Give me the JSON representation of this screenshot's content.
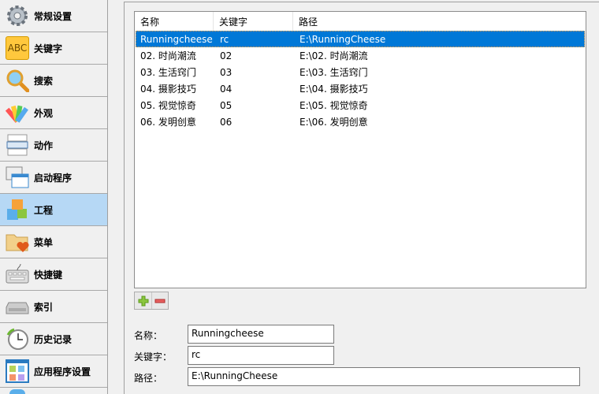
{
  "sidebar": {
    "items": [
      {
        "label": "常规设置",
        "icon": "gear-icon"
      },
      {
        "label": "关键字",
        "icon": "abc-icon",
        "icon_text": "ABC"
      },
      {
        "label": "搜索",
        "icon": "magnifier-icon"
      },
      {
        "label": "外观",
        "icon": "palette-icon"
      },
      {
        "label": "动作",
        "icon": "action-list-icon"
      },
      {
        "label": "启动程序",
        "icon": "windows-icon"
      },
      {
        "label": "工程",
        "icon": "blocks-icon",
        "selected": true
      },
      {
        "label": "菜单",
        "icon": "folder-heart-icon"
      },
      {
        "label": "快捷键",
        "icon": "keyboard-icon"
      },
      {
        "label": "索引",
        "icon": "drive-icon"
      },
      {
        "label": "历史记录",
        "icon": "clock-icon"
      },
      {
        "label": "应用程序设置",
        "icon": "app-settings-icon"
      }
    ]
  },
  "table": {
    "headers": [
      "名称",
      "关键字",
      "路径"
    ],
    "rows": [
      [
        "Runningcheese",
        "rc",
        "E:\\RunningCheese"
      ],
      [
        "02. 时尚潮流",
        "02",
        "E:\\02. 时尚潮流"
      ],
      [
        "03. 生活窍门",
        "03",
        "E:\\03. 生活窍门"
      ],
      [
        "04. 摄影技巧",
        "04",
        "E:\\04. 摄影技巧"
      ],
      [
        "05. 视觉惊奇",
        "05",
        "E:\\05. 视觉惊奇"
      ],
      [
        "06. 发明创意",
        "06",
        "E:\\06. 发明创意"
      ]
    ]
  },
  "form": {
    "name_label": "名称：",
    "name_value": "Runningcheese",
    "keyword_label": "关键字：",
    "keyword_value": "rc",
    "path_label": "路径：",
    "path_value": "E:\\RunningCheese"
  },
  "colors": {
    "selection": "#0078d7",
    "sidebar_selected": "#b6d8f5"
  }
}
